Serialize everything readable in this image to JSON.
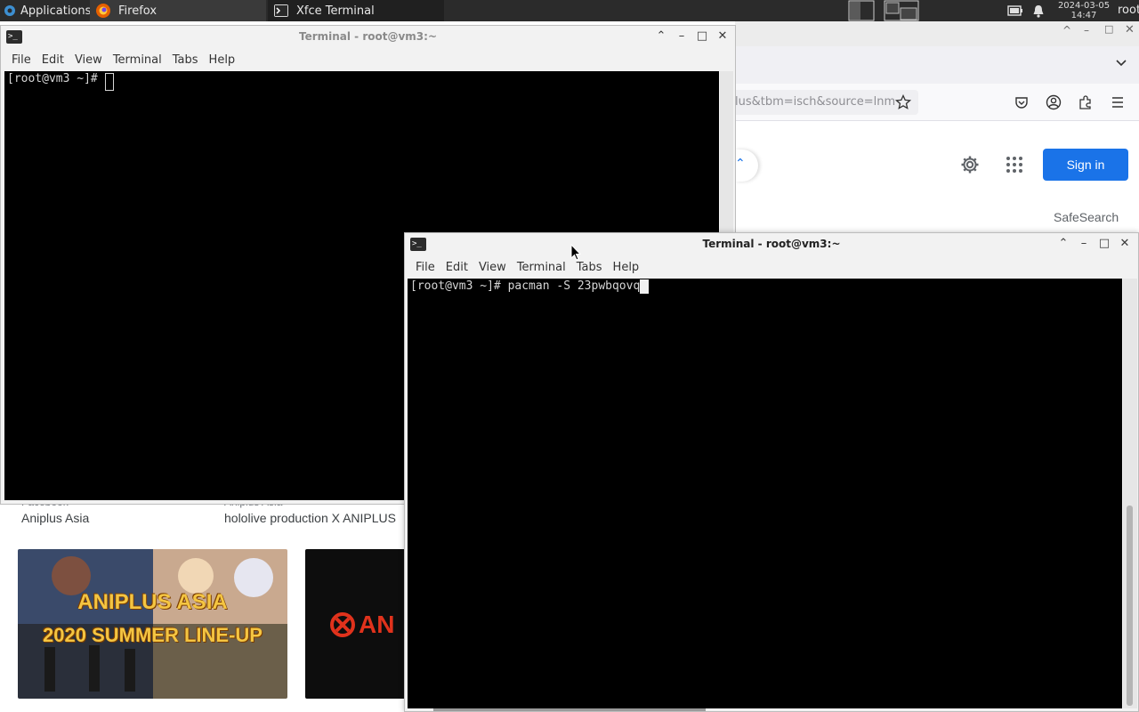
{
  "panel": {
    "applications_label": "Applications",
    "tasks": [
      {
        "label": "Firefox",
        "icon": "firefox-icon"
      },
      {
        "label": "Xfce Terminal",
        "icon": "terminal-icon"
      }
    ],
    "clock_date": "2024-03-05",
    "clock_time": "14:47",
    "user": "root"
  },
  "firefox": {
    "url_fragment": "lus&tbm=isch&source=lnm",
    "sign_in_label": "Sign in",
    "safesearch_label": "SafeSearch",
    "results": [
      {
        "source": "Aniplus Asia",
        "meta": "Facebook"
      },
      {
        "source": "hololive production X ANIPLUS",
        "meta": "Aniplus Asia"
      }
    ],
    "thumb1_line1": "ANIPLUS ASIA",
    "thumb1_line2": "2020 SUMMER LINE-UP",
    "thumb2_text": "AN",
    "accent": "#1a73e8"
  },
  "terminal_back": {
    "title": "Terminal - root@vm3:~",
    "menu": [
      "File",
      "Edit",
      "View",
      "Terminal",
      "Tabs",
      "Help"
    ],
    "prompt": "[root@vm3 ~]# ",
    "command": ""
  },
  "terminal_front": {
    "title": "Terminal - root@vm3:~",
    "menu": [
      "File",
      "Edit",
      "View",
      "Terminal",
      "Tabs",
      "Help"
    ],
    "prompt": "[root@vm3 ~]# ",
    "command": "pacman -S 23pwbqovq"
  }
}
